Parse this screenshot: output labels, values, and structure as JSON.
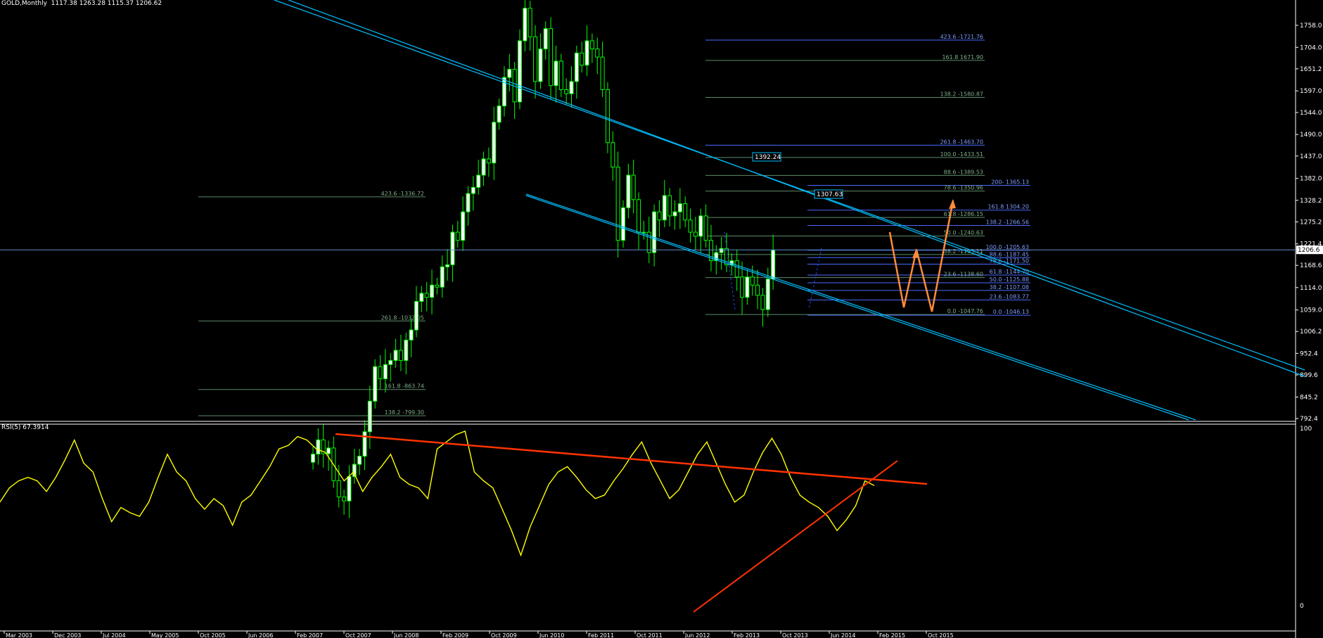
{
  "header": {
    "symbol": "GOLD,Monthly",
    "ohlc": "1117.38 1263.28 1115.37 1206.62"
  },
  "rsi_header": "RSI(5) 67.3914",
  "colors": {
    "background": "#000000",
    "bull_candle": "#ffffff",
    "bear_candle": "#000000",
    "candle_outline": "#00ff00",
    "channel": "#00bfff",
    "fib_green": "#5d8a6a",
    "fib_blue": "#4a6bff",
    "rsi_line": "#ffff00",
    "trendline": "#ff3300",
    "arrow": "#ff8c3a",
    "axis_text": "#ffffff",
    "price_line": "#5f8dc8"
  },
  "chart_data": [
    {
      "type": "candlestick",
      "title": "GOLD,Monthly",
      "ohlc_last": {
        "open": 1117.38,
        "high": 1263.28,
        "low": 1115.37,
        "close": 1206.62
      },
      "current_price": 1206.62,
      "y_ticks": [
        792.4,
        845.2,
        899.6,
        952.4,
        1006.2,
        1059.0,
        1114.0,
        1168.6,
        1221.4,
        1275.2,
        1328.2,
        1382.0,
        1437.0,
        1490.0,
        1544.0,
        1597.0,
        1651.2,
        1704.0,
        1758.0
      ],
      "x_ticks": [
        "Mar 2003",
        "Dec 2003",
        "Jul 2004",
        "May 2005",
        "Oct 2005",
        "Jun 2006",
        "Feb 2007",
        "Oct 2007",
        "Jun 2008",
        "Feb 2009",
        "Oct 2009",
        "Jun 2010",
        "Feb 2011",
        "Oct 2011",
        "Jun 2012",
        "Feb 2013",
        "Oct 2013",
        "Jun 2014",
        "Feb 2015",
        "Oct 2015"
      ],
      "ylim": [
        792.4,
        1758.0
      ],
      "close_series": [
        705,
        740,
        706,
        720,
        640,
        600,
        590,
        650,
        680,
        700,
        760,
        835,
        920,
        890,
        925,
        935,
        960,
        935,
        985,
        1010,
        1080,
        1100,
        1090,
        1120,
        1115,
        1165,
        1170,
        1250,
        1230,
        1300,
        1345,
        1360,
        1390,
        1430,
        1420,
        1520,
        1560,
        1630,
        1650,
        1570,
        1720,
        1800,
        1730,
        1620,
        1700,
        1750,
        1610,
        1670,
        1600,
        1590,
        1620,
        1690,
        1660,
        1720,
        1700,
        1680,
        1600,
        1470,
        1410,
        1230,
        1310,
        1390,
        1330,
        1250,
        1250,
        1200,
        1300,
        1280,
        1340,
        1290,
        1300,
        1320,
        1280,
        1250,
        1240,
        1290,
        1230,
        1180,
        1200,
        1210,
        1170,
        1180,
        1140,
        1090,
        1140,
        1120,
        1095,
        1060,
        1135,
        1206
      ],
      "fibonacci_levels": [
        {
          "label": "423.6 -1721.76",
          "value": 1721.76
        },
        {
          "label": "161.8 1671.90",
          "value": 1671.9
        },
        {
          "label": "138.2 -1580.87",
          "value": 1580.87
        },
        {
          "label": "261.8 -1463.70",
          "value": 1463.7
        },
        {
          "label": "100.0 -1433.51",
          "value": 1433.51
        },
        {
          "label": "88.6 -1389.53",
          "value": 1389.53
        },
        {
          "label": "200- 1365.13",
          "value": 1365.13
        },
        {
          "label": "78.6 -1350.96",
          "value": 1350.96
        },
        {
          "label": "161.8 1304.20",
          "value": 1304.2
        },
        {
          "label": "61.8 -1286.15",
          "value": 1286.15
        },
        {
          "label": "138.2 -1266.56",
          "value": 1266.56
        },
        {
          "label": "50.0 -1240.63",
          "value": 1240.63
        },
        {
          "label": "100.0 -1205.63",
          "value": 1205.63
        },
        {
          "label": "38.2 -1195.11",
          "value": 1195.11
        },
        {
          "label": "88.6 -1187.45",
          "value": 1187.45
        },
        {
          "label": "78.6 -1171.50",
          "value": 1171.5
        },
        {
          "label": "61.8 -1144.70",
          "value": 1144.7
        },
        {
          "label": "23.6 -1138.60",
          "value": 1138.6
        },
        {
          "label": "50.0 -1125.88",
          "value": 1125.88
        },
        {
          "label": "38.2 -1107.08",
          "value": 1107.08
        },
        {
          "label": "23.6 -1083.77",
          "value": 1083.77
        },
        {
          "label": "0.0 -1047.76",
          "value": 1047.76
        },
        {
          "label": "0.0 -1046.13",
          "value": 1046.13
        },
        {
          "label": "423.6 -1336.72",
          "value": 1336.72
        },
        {
          "label": "261.8 -1032.05",
          "value": 1032.05
        },
        {
          "label": "161.8 -863.74",
          "value": 863.74
        },
        {
          "label": "138.2 -799.30",
          "value": 799.3
        }
      ],
      "price_labels": [
        "1392.24",
        "1307.63"
      ],
      "current_price_label": "1206.6"
    },
    {
      "type": "line",
      "title": "RSI(5) 67.3914",
      "ylim": [
        0,
        100
      ],
      "y_ticks": [
        0,
        100
      ],
      "value_last": 67.3914,
      "series": [
        {
          "values": [
            58,
            66,
            70,
            72,
            70,
            64,
            72,
            82,
            93,
            80,
            75,
            60,
            47,
            55,
            52,
            50,
            58,
            72,
            85,
            75,
            70,
            60,
            54,
            60,
            56,
            45,
            58,
            62,
            70,
            78,
            88,
            90,
            95,
            93,
            88,
            86,
            78,
            70,
            75,
            64,
            72,
            78,
            85,
            72,
            68,
            66,
            60,
            88,
            92,
            96,
            98,
            75,
            70,
            66,
            54,
            42,
            28,
            44,
            56,
            68,
            75,
            78,
            72,
            65,
            60,
            62,
            70,
            77,
            85,
            92,
            80,
            70,
            60,
            65,
            75,
            85,
            92,
            80,
            68,
            58,
            62,
            75,
            86,
            94,
            85,
            72,
            62,
            58,
            55,
            50,
            42,
            48,
            56,
            70,
            67.39
          ]
        }
      ]
    }
  ]
}
